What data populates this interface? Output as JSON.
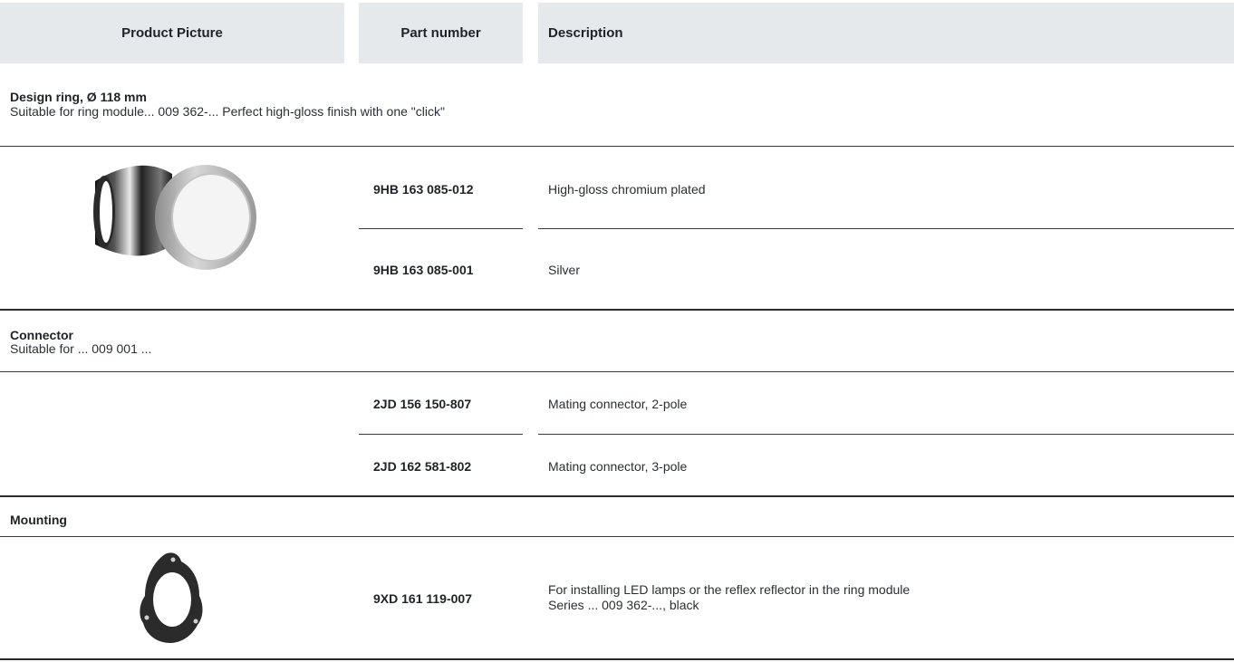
{
  "header": {
    "col_picture": "Product Picture",
    "col_part_number": "Part number",
    "col_description": "Description"
  },
  "sections": [
    {
      "title": "Design ring, Ø 118 mm",
      "subtitle": "Suitable for ring module... 009 362-... Perfect high-gloss finish with one \"click\"",
      "items": [
        {
          "part_number": "9HB 163 085-012",
          "description": "High-gloss chromium plated"
        },
        {
          "part_number": "9HB 163 085-001",
          "description": "Silver"
        }
      ]
    },
    {
      "title": "Connector",
      "subtitle": "Suitable for ... 009 001 ...",
      "items": [
        {
          "part_number": "2JD 156 150-807",
          "description": "Mating connector, 2-pole"
        },
        {
          "part_number": "2JD 162 581-802",
          "description": "Mating connector, 3-pole"
        }
      ]
    },
    {
      "title": "Mounting",
      "items": [
        {
          "part_number": "9XD 161 119-007",
          "description_line1": "For installing LED lamps or the reflex reflector in the ring module",
          "description_line2": "Series ... 009 362-..., black"
        }
      ]
    }
  ]
}
